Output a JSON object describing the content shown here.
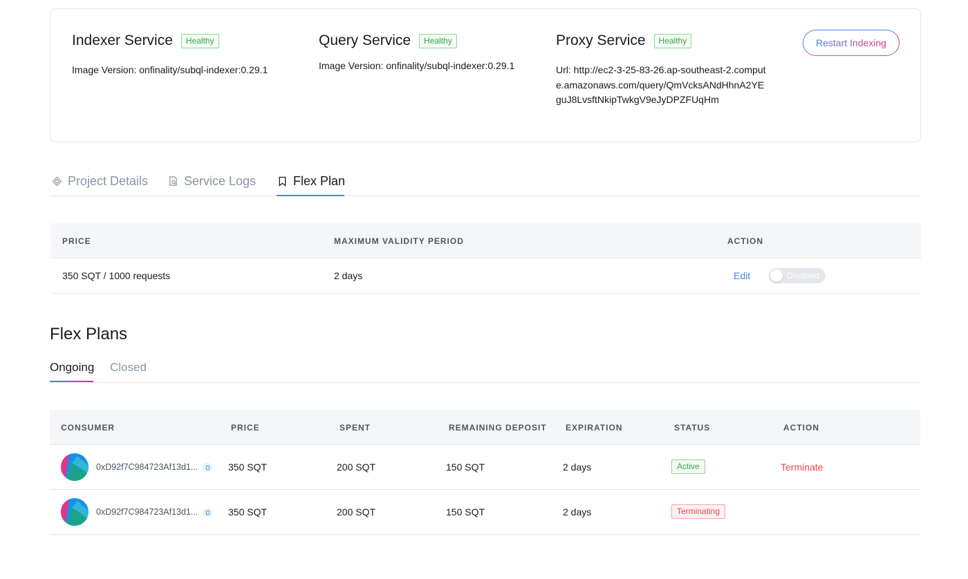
{
  "services": {
    "indexer": {
      "name": "Indexer Service",
      "status": "Healthy",
      "detail": "Image Version: onfinality/subql-indexer:0.29.1"
    },
    "query": {
      "name": "Query Service",
      "status": "Healthy",
      "detail": "Image Version: onfinality/subql-indexer:0.29.1"
    },
    "proxy": {
      "name": "Proxy Service",
      "status": "Healthy",
      "detail": "Url: http://ec2-3-25-83-26.ap-southeast-2.compute.amazonaws.com/query/QmVcksANdHhnA2YEguJ8LvsftNkipTwkgV9eJyDPZFUqHm"
    },
    "restart_label": "Restart Indexing"
  },
  "main_tabs": [
    {
      "label": "Project Details",
      "icon": "diamond-icon"
    },
    {
      "label": "Service Logs",
      "icon": "file-search-icon"
    },
    {
      "label": "Flex Plan",
      "icon": "bookmark-icon"
    }
  ],
  "price_table": {
    "headers": {
      "price": "PRICE",
      "validity": "MAXIMUM VALIDITY PERIOD",
      "action": "ACTION"
    },
    "row": {
      "price": "350 SQT / 1000 requests",
      "validity": "2 days",
      "edit": "Edit",
      "toggle_label": "Disabled"
    }
  },
  "flex_plans": {
    "title": "Flex Plans",
    "tabs": [
      "Ongoing",
      "Closed"
    ],
    "headers": {
      "consumer": "CONSUMER",
      "price": "PRICE",
      "spent": "SPENT",
      "remaining": "REMAINING DEPOSIT",
      "expiration": "EXPIRATION",
      "status": "STATUS",
      "action": "ACTION"
    },
    "rows": [
      {
        "consumer": "0xD92f7C984723Af13d1...",
        "price": "350 SQT",
        "spent": "200 SQT",
        "remaining": "150 SQT",
        "expiration": "2 days",
        "status": "Active",
        "action": "Terminate"
      },
      {
        "consumer": "0xD92f7C984723Af13d1...",
        "price": "350 SQT",
        "spent": "200 SQT",
        "remaining": "150 SQT",
        "expiration": "2 days",
        "status": "Terminating",
        "action": ""
      }
    ]
  },
  "colors": {
    "accent_blue": "#4388dd",
    "accent_pink": "#e5338a",
    "healthy_green": "#3aa346",
    "danger_red": "#e5484d"
  }
}
